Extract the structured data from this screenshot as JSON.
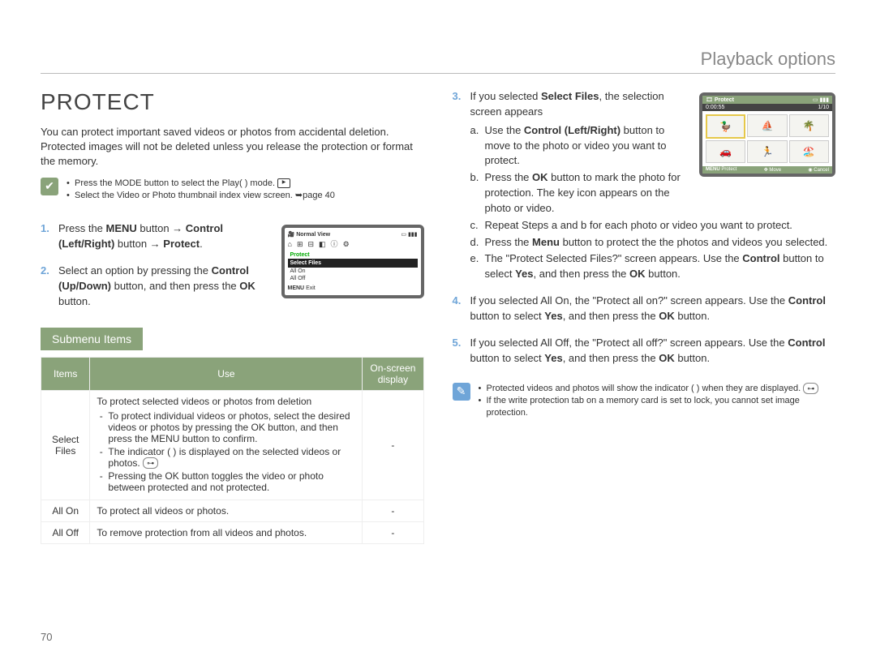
{
  "header": "Playback options",
  "page_number": "70",
  "left": {
    "title": "PROTECT",
    "intro": "You can protect important saved videos or photos from accidental deletion. Protected images will not be deleted unless you release the protection or format the memory.",
    "check_notes": [
      "Press the MODE button to select the Play(  ) mode.",
      "Select the Video or Photo thumbnail index view screen. ➥page 40"
    ],
    "step1_a": "Press the ",
    "step1_menu": "MENU",
    "step1_b": " button → ",
    "step1_control": "Control (Left/Right)",
    "step1_c": " button → ",
    "step1_protect": "Protect",
    "step1_d": ".",
    "step2_a": "Select an option by pressing the ",
    "step2_control": "Control (Up/Down)",
    "step2_b": " button, and then press the ",
    "step2_ok": "OK",
    "step2_c": " button.",
    "lcd": {
      "normal_view": "Normal View",
      "protect": "Protect",
      "select_files": "Select Files",
      "all_on": "All On",
      "all_off": "All Off",
      "exit": "Exit",
      "menu_label": "MENU"
    },
    "submenu_title": "Submenu Items",
    "table": {
      "head": {
        "items": "Items",
        "use": "Use",
        "osd": "On-screen display"
      },
      "rows": [
        {
          "item": "Select Files",
          "use_lead": "To protect selected videos or photos from deletion",
          "bullets": [
            "To protect individual videos or photos, select the desired videos or photos by pressing the OK button, and then press the MENU button to confirm.",
            "The indicator (  ) is displayed on the selected videos or photos.",
            "Pressing the OK button toggles the video or photo between protected and not protected."
          ],
          "osd": "-"
        },
        {
          "item": "All On",
          "use_lead": "To protect all videos or photos.",
          "osd": "-"
        },
        {
          "item": "All Off",
          "use_lead": "To remove protection from all videos and photos.",
          "osd": "-"
        }
      ]
    }
  },
  "right": {
    "step3_lead_a": "If you selected ",
    "step3_lead_b": "Select Files",
    "step3_lead_c": ", the selection screen appears",
    "step3": {
      "a": {
        "pre": "Use the ",
        "bold": "Control (Left/Right)",
        "post": " button to move to the photo or video you want to protect."
      },
      "b": {
        "pre": "Press the ",
        "bold": "OK",
        "post": " button to mark the photo for protection. The key icon appears on the photo or video."
      },
      "c": "Repeat Steps a and b for each photo or video you want to protect.",
      "d": {
        "pre": "Press the ",
        "bold": "Menu",
        "post": " button to protect the the photos and videos you selected."
      },
      "e": {
        "pre": "The \"Protect Selected Files?\" screen appears. Use the ",
        "bold1": "Control",
        "mid": " button to select ",
        "bold2": "Yes",
        "post": ", and then press the ",
        "bold3": "OK",
        "tail": " button."
      }
    },
    "step4": {
      "pre": "If you selected All On, the \"Protect all on?\" screen appears. Use the ",
      "b1": "Control",
      "mid": " button to select ",
      "b2": "Yes",
      "post": ", and then press the ",
      "b3": "OK",
      "tail": " button."
    },
    "step5": {
      "pre": "If you selected All Off, the \"Protect all off?\" screen appears. Use the ",
      "b1": "Control",
      "mid": " button to select ",
      "b2": "Yes",
      "post": ", and then press the ",
      "b3": "OK",
      "tail": " button."
    },
    "tip_notes": [
      "Protected videos and photos will show the indicator (  ) when they are displayed.",
      "If the write protection tab on a memory card is set to lock, you cannot set image protection."
    ],
    "lcd2": {
      "title": "Protect",
      "time": "0:00:55",
      "count": "1/10",
      "menu": "MENU",
      "protect": "Protect",
      "move": "Move",
      "cancel": "Cancel"
    }
  }
}
